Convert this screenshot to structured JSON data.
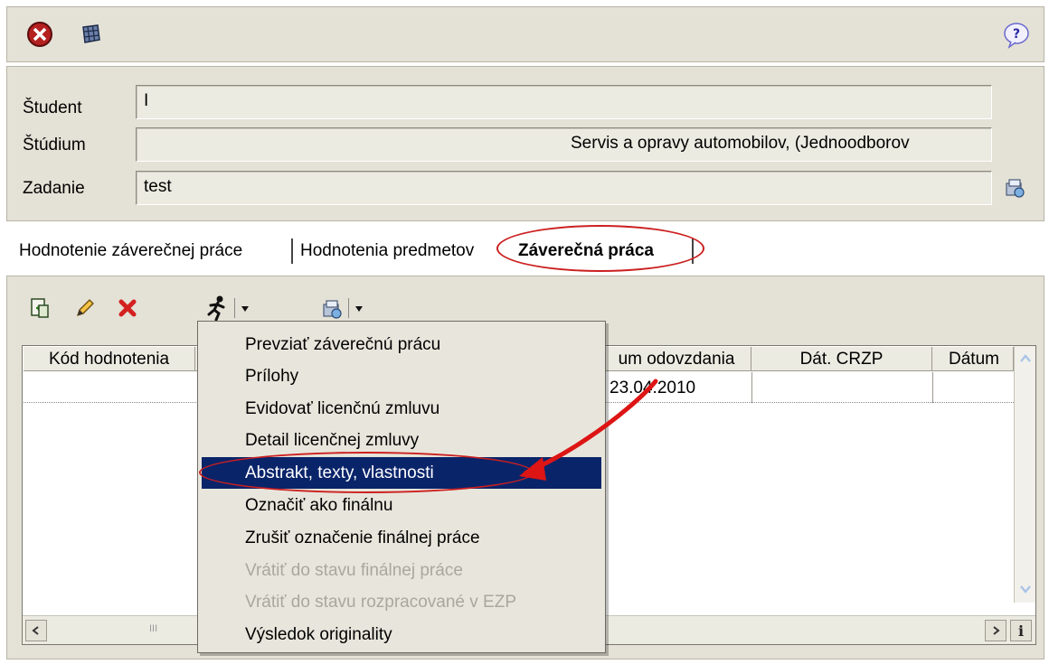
{
  "toolbar": {
    "close_icon": "close-icon",
    "grid_icon": "grid-icon",
    "help_icon": "help-icon"
  },
  "form": {
    "student_label": "Študent",
    "student_value": "I",
    "studium_label": "Štúdium",
    "studium_value": "Servis a opravy automobilov, (Jednoodborov",
    "zadanie_label": "Zadanie",
    "zadanie_value": "test"
  },
  "tabs": [
    {
      "label": "Hodnotenie záverečnej práce"
    },
    {
      "label": "Hodnotenia predmetov"
    },
    {
      "label": "Záverečná práca"
    }
  ],
  "table": {
    "columns": [
      "Kód hodnotenia",
      "um odovzdania",
      "Dát. CRZP",
      "Dátum"
    ],
    "rows": [
      {
        "datum_odovzdania": "23.04.2010"
      }
    ]
  },
  "menu": {
    "items": [
      {
        "label": "Prevziať záverečnú prácu",
        "state": "enabled"
      },
      {
        "label": "Prílohy",
        "state": "enabled"
      },
      {
        "label": "Evidovať licenčnú zmluvu",
        "state": "enabled"
      },
      {
        "label": "Detail licenčnej zmluvy",
        "state": "enabled"
      },
      {
        "label": "Abstrakt, texty, vlastnosti",
        "state": "selected"
      },
      {
        "label": "Označiť ako finálnu",
        "state": "enabled"
      },
      {
        "label": "Zrušiť označenie finálnej práce",
        "state": "enabled"
      },
      {
        "label": "Vrátiť do stavu finálnej práce",
        "state": "disabled"
      },
      {
        "label": "Vrátiť do stavu rozpracované v EZP",
        "state": "disabled"
      },
      {
        "label": "Výsledok originality",
        "state": "enabled"
      }
    ]
  },
  "scroll": {
    "hscroll_grip": "III",
    "info_button": "i"
  },
  "colors": {
    "panel_bg": "#e4e1d6",
    "selection": "#0a246a",
    "annotation_red": "#cc2020"
  }
}
